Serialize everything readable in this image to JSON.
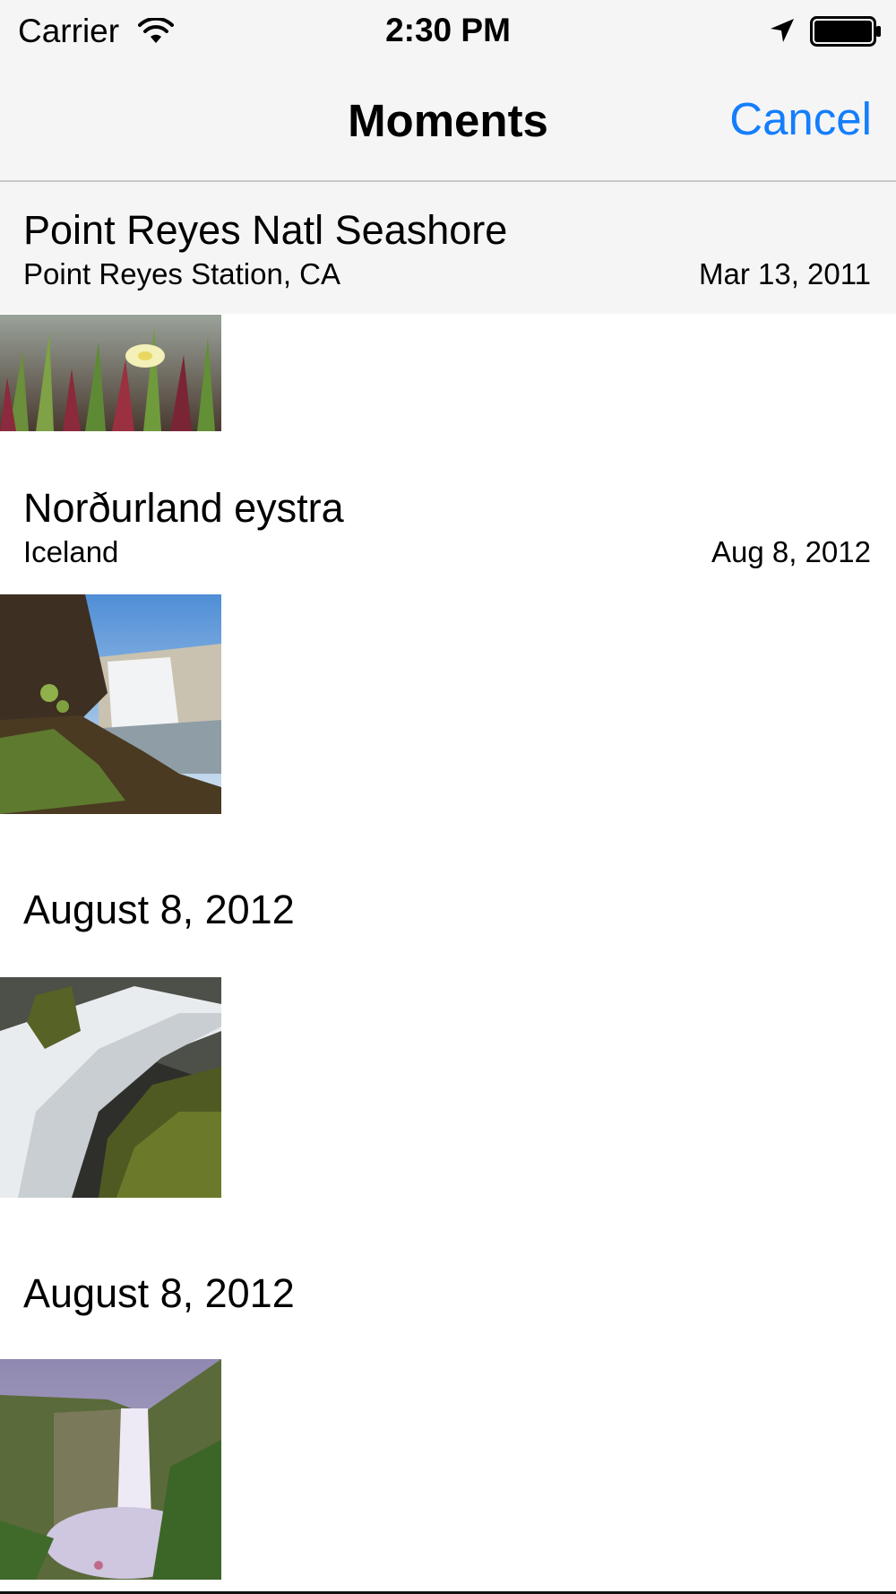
{
  "status_bar": {
    "carrier": "Carrier",
    "time": "2:30 PM",
    "icons": [
      "wifi-icon",
      "location-arrow-icon",
      "battery-icon"
    ]
  },
  "nav": {
    "title": "Moments",
    "cancel_label": "Cancel",
    "accent_color": "#147efb"
  },
  "moments": [
    {
      "title": "Point Reyes Natl Seashore",
      "location": "Point Reyes Station, CA",
      "date": "Mar 13, 2011",
      "photo": "ice-plant-flower-photo"
    },
    {
      "title": "Norðurland eystra",
      "location": "Iceland",
      "date": "Aug 8, 2012",
      "photo": "waterfall-cliff-photo"
    },
    {
      "title": "August 8, 2012",
      "photo": "cascading-waterfall-moss-photo"
    },
    {
      "title": "August 8, 2012",
      "photo": "waterfall-canyon-mist-photo"
    }
  ]
}
